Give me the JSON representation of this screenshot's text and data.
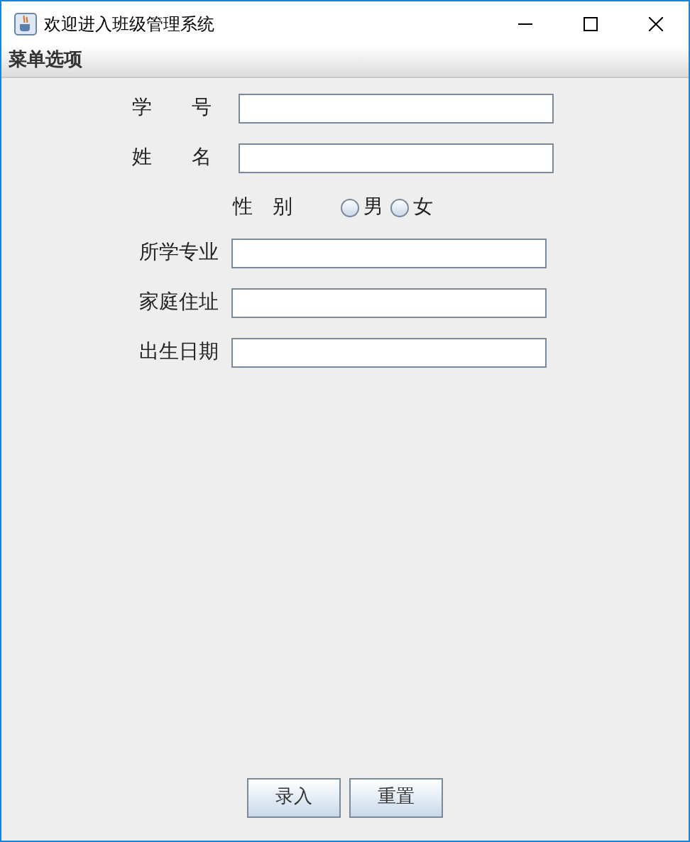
{
  "window": {
    "title": "欢迎进入班级管理系统"
  },
  "menu_bar": {
    "items": [
      "菜单选项"
    ]
  },
  "form": {
    "top_fields": [
      {
        "label": "学　　号"
      },
      {
        "label": "姓　　名"
      }
    ],
    "gender": {
      "label": "性　别",
      "options": [
        {
          "label": "男",
          "selected": false
        },
        {
          "label": "女",
          "selected": false
        }
      ]
    },
    "fields": [
      {
        "label": "所学专业"
      },
      {
        "label": "家庭住址"
      },
      {
        "label": "出生日期"
      }
    ]
  },
  "buttons": [
    "录入",
    "重置"
  ]
}
